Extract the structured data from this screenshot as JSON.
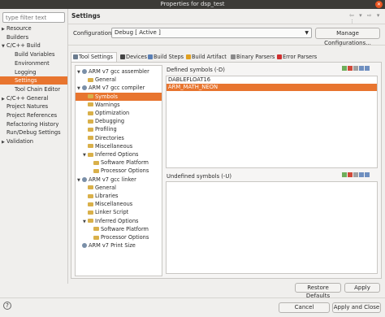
{
  "window": {
    "title": "Properties for dsp_test"
  },
  "left": {
    "filter_placeholder": "type filter text",
    "items": [
      {
        "label": "Resource",
        "expander": "▶"
      },
      {
        "label": "Builders",
        "expander": ""
      },
      {
        "label": "C/C++ Build",
        "expander": "▼"
      },
      {
        "label": "Build Variables",
        "expander": ""
      },
      {
        "label": "Environment",
        "expander": ""
      },
      {
        "label": "Logging",
        "expander": ""
      },
      {
        "label": "Settings",
        "expander": ""
      },
      {
        "label": "Tool Chain Editor",
        "expander": ""
      },
      {
        "label": "C/C++ General",
        "expander": "▶"
      },
      {
        "label": "Project Natures",
        "expander": ""
      },
      {
        "label": "Project References",
        "expander": ""
      },
      {
        "label": "Refactoring History",
        "expander": ""
      },
      {
        "label": "Run/Debug Settings",
        "expander": ""
      },
      {
        "label": "Validation",
        "expander": "▶"
      }
    ]
  },
  "header": {
    "title": "Settings",
    "nav": "⇦ ▾ ⇨ ▾ ⋮"
  },
  "config": {
    "label": "Configuration:",
    "value": "Debug  [ Active ]",
    "manage_label": "Manage Configurations..."
  },
  "tabs": [
    {
      "label": "Tool Settings",
      "color": "#6b7c8f"
    },
    {
      "label": "Devices",
      "color": "#444444"
    },
    {
      "label": "Build Steps",
      "color": "#5a7fb5"
    },
    {
      "label": "Build Artifact",
      "color": "#e0a020"
    },
    {
      "label": "Binary Parsers",
      "color": "#8a8a8a"
    },
    {
      "label": "Error Parsers",
      "color": "#d03030"
    }
  ],
  "tool_tree": [
    {
      "label": "ARM v7 gcc assembler",
      "exp": "▼",
      "icon": "gear"
    },
    {
      "label": "General",
      "exp": "",
      "icon": "folder"
    },
    {
      "label": "ARM v7 gcc compiler",
      "exp": "▼",
      "icon": "gear"
    },
    {
      "label": "Symbols",
      "exp": "",
      "icon": "folder"
    },
    {
      "label": "Warnings",
      "exp": "",
      "icon": "folder"
    },
    {
      "label": "Optimization",
      "exp": "",
      "icon": "folder"
    },
    {
      "label": "Debugging",
      "exp": "",
      "icon": "folder"
    },
    {
      "label": "Profiling",
      "exp": "",
      "icon": "folder"
    },
    {
      "label": "Directories",
      "exp": "",
      "icon": "folder"
    },
    {
      "label": "Miscellaneous",
      "exp": "",
      "icon": "folder"
    },
    {
      "label": "Inferred Options",
      "exp": "▼",
      "icon": "folder"
    },
    {
      "label": "Software Platform",
      "exp": "",
      "icon": "folder"
    },
    {
      "label": "Processor Options",
      "exp": "",
      "icon": "folder"
    },
    {
      "label": "ARM v7 gcc linker",
      "exp": "▼",
      "icon": "gear"
    },
    {
      "label": "General",
      "exp": "",
      "icon": "folder"
    },
    {
      "label": "Libraries",
      "exp": "",
      "icon": "folder"
    },
    {
      "label": "Miscellaneous",
      "exp": "",
      "icon": "folder"
    },
    {
      "label": "Linker Script",
      "exp": "",
      "icon": "folder"
    },
    {
      "label": "Inferred Options",
      "exp": "▼",
      "icon": "folder"
    },
    {
      "label": "Software Platform",
      "exp": "",
      "icon": "folder"
    },
    {
      "label": "Processor Options",
      "exp": "",
      "icon": "folder"
    },
    {
      "label": "ARM v7 Print Size",
      "exp": "",
      "icon": "gear"
    }
  ],
  "defined": {
    "label": "Defined symbols (-D)",
    "values": [
      "DABLEFLOAT16",
      "ARM_MATH_NEON"
    ]
  },
  "undefined": {
    "label": "Undefined symbols (-U)"
  },
  "buttons": {
    "restore": "Restore Defaults",
    "apply": "Apply",
    "cancel": "Cancel",
    "apply_close": "Apply and Close",
    "help": "?"
  }
}
